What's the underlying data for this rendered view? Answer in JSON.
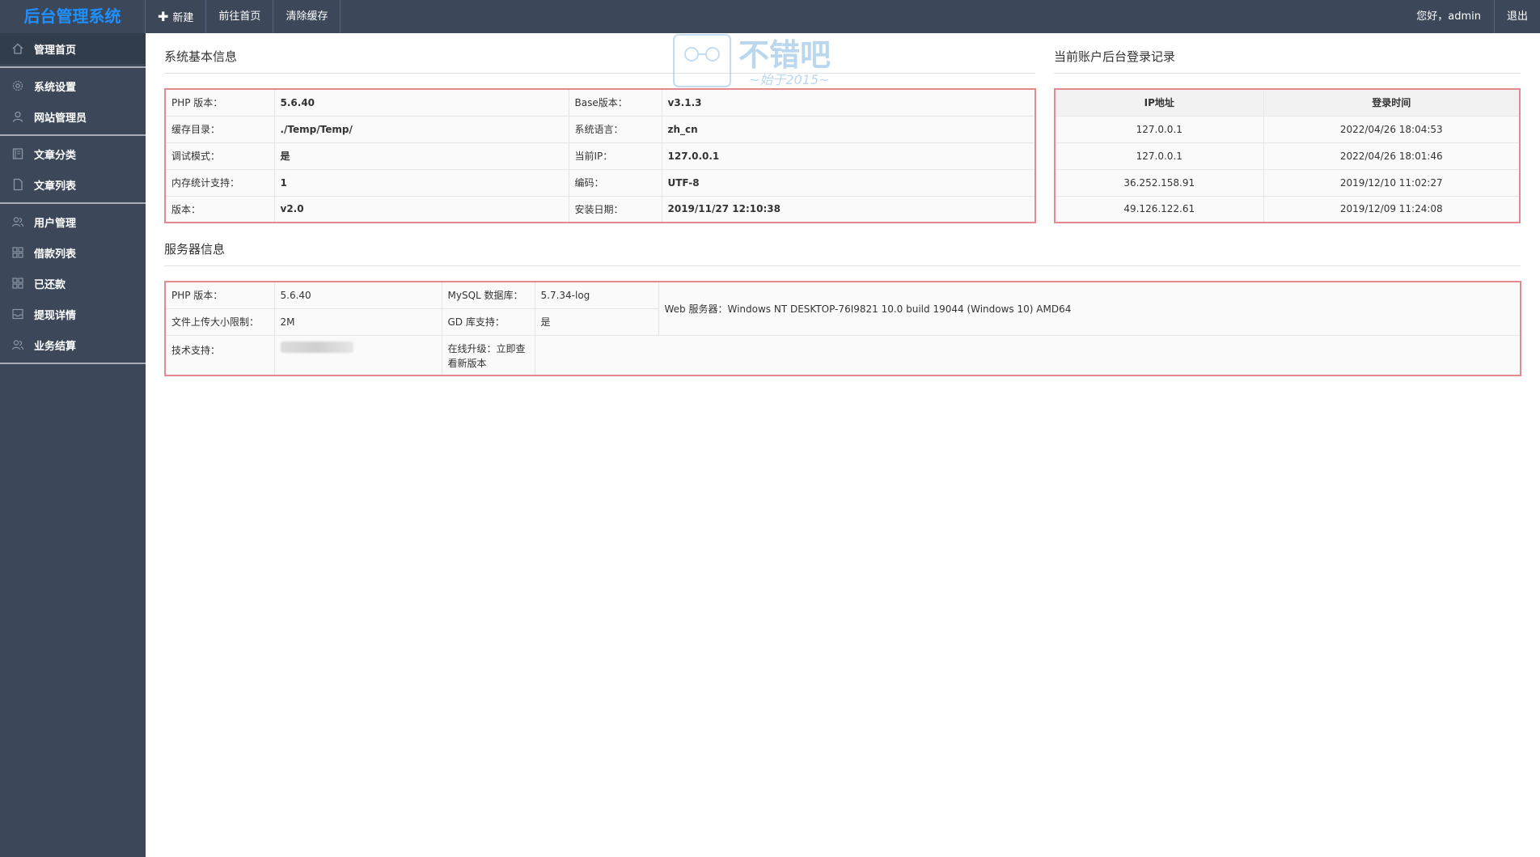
{
  "app": {
    "title": "后台管理系统"
  },
  "topnav": {
    "new_label": "新建",
    "home_label": "前往首页",
    "cache_label": "清除缓存"
  },
  "user": {
    "greeting": "您好，admin",
    "logout_label": "退出"
  },
  "sidebar": {
    "items": [
      {
        "label": "管理首页",
        "icon": "home-icon"
      },
      {
        "label": "系统设置",
        "icon": "gear-icon"
      },
      {
        "label": "网站管理员",
        "icon": "user-icon"
      },
      {
        "label": "文章分类",
        "icon": "book-icon"
      },
      {
        "label": "文章列表",
        "icon": "document-icon"
      },
      {
        "label": "用户管理",
        "icon": "users-icon"
      },
      {
        "label": "借款列表",
        "icon": "grid-icon"
      },
      {
        "label": "已还款",
        "icon": "grid-icon"
      },
      {
        "label": "提现详情",
        "icon": "inbox-icon"
      },
      {
        "label": "业务结算",
        "icon": "users-icon"
      }
    ]
  },
  "system_info": {
    "title": "系统基本信息",
    "rows": [
      {
        "k1": "PHP 版本：",
        "v1": "5.6.40",
        "k2": "Base版本：",
        "v2": "v3.1.3"
      },
      {
        "k1": "缓存目录：",
        "v1": "./Temp/Temp/",
        "k2": "系统语言：",
        "v2": "zh_cn"
      },
      {
        "k1": "调试模式：",
        "v1": "是",
        "k2": "当前IP：",
        "v2": "127.0.0.1"
      },
      {
        "k1": "内存统计支持：",
        "v1": "1",
        "k2": "编码：",
        "v2": "UTF-8"
      },
      {
        "k1": "版本：",
        "v1": "v2.0",
        "k2": "安装日期：",
        "v2": "2019/11/27 12:10:38"
      }
    ]
  },
  "login_records": {
    "title": "当前账户后台登录记录",
    "headers": [
      "IP地址",
      "登录时间"
    ],
    "rows": [
      {
        "ip": "127.0.0.1",
        "time": "2022/04/26 18:04:53"
      },
      {
        "ip": "127.0.0.1",
        "time": "2022/04/26 18:01:46"
      },
      {
        "ip": "36.252.158.91",
        "time": "2019/12/10 11:02:27"
      },
      {
        "ip": "49.126.122.61",
        "time": "2019/12/09 11:24:08"
      }
    ]
  },
  "server_info": {
    "title": "服务器信息",
    "php_label": "PHP 版本：",
    "php_value": "5.6.40",
    "mysql_label": "MySQL 数据库：",
    "mysql_value": "5.7.34-log",
    "upload_label": "文件上传大小限制：",
    "upload_value": "2M",
    "gd_label": "GD 库支持：",
    "gd_value": "是",
    "web_server": "Web 服务器：Windows NT DESKTOP-76I9821 10.0 build 19044 (Windows 10) AMD64",
    "support_label": "技术支持：",
    "upgrade_line1": "在线升级：立即查",
    "upgrade_line2": "看新版本"
  },
  "watermark": {
    "main": "不错吧",
    "sub": "~始于2015~"
  },
  "colors": {
    "sidebar_bg": "#3c4859",
    "brand": "#1e90ff",
    "table_border": "#e58890"
  }
}
